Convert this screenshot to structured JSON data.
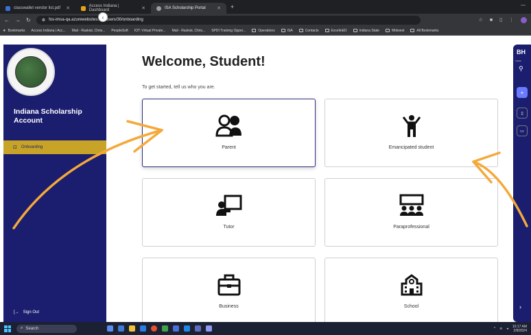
{
  "browser": {
    "tabs": [
      {
        "title": "classwallet vendor list.pdf",
        "fav_color": "#3b6fd8",
        "active": false
      },
      {
        "title": "Access Indiana | Dashboard",
        "fav_color": "#e6a21a",
        "active": false
      },
      {
        "title": "ISA Scholarship Portal",
        "fav_color": "#9aa0a6",
        "active": true
      }
    ],
    "new_tab": "+",
    "url": "fos-imsa-qa.azurewebsites.net/users/30/onboarding",
    "bookmarks": [
      "Bookmarks",
      "Access Indiana | Acc...",
      "Mail - Raskist, Chris...",
      "PeopleSoft",
      "IOT: Virtual Private...",
      "Mail - Raskist, Chris...",
      "SPDI Training Oppor...",
      "Operations",
      "ISA",
      "Contacts",
      "ExcelinED",
      "Indiana State",
      "Midwest",
      "All Bookmarks"
    ]
  },
  "sidebar": {
    "collapse_icon": "‹",
    "account_title": "Indiana Scholarship Account",
    "nav_items": [
      {
        "label": "Onboarding",
        "active": true
      }
    ],
    "sign_out_label": "Sign Out"
  },
  "main": {
    "heading": "Welcome, Student!",
    "subtitle": "To get started, tell us who you are.",
    "options": [
      {
        "label": "Parent",
        "icon": "parent-icon",
        "selected": true
      },
      {
        "label": "Emancipated student",
        "icon": "emancipated-student-icon",
        "selected": false
      },
      {
        "label": "Tutor",
        "icon": "tutor-icon",
        "selected": false
      },
      {
        "label": "Paraprofessional",
        "icon": "paraprofessional-icon",
        "selected": false
      },
      {
        "label": "Business",
        "icon": "business-icon",
        "selected": false
      },
      {
        "label": "School",
        "icon": "school-icon",
        "selected": false
      }
    ]
  },
  "right_panel": {
    "brand": "BH",
    "small_text": "TOMS",
    "expand_icon": "›"
  },
  "taskbar": {
    "search_placeholder": "Search",
    "time": "10:17 AM",
    "date": "2/8/2024"
  },
  "colors": {
    "sidebar_bg": "#1b1e6e",
    "active_nav": "#c7a427",
    "annotation": "#f4a93a"
  }
}
